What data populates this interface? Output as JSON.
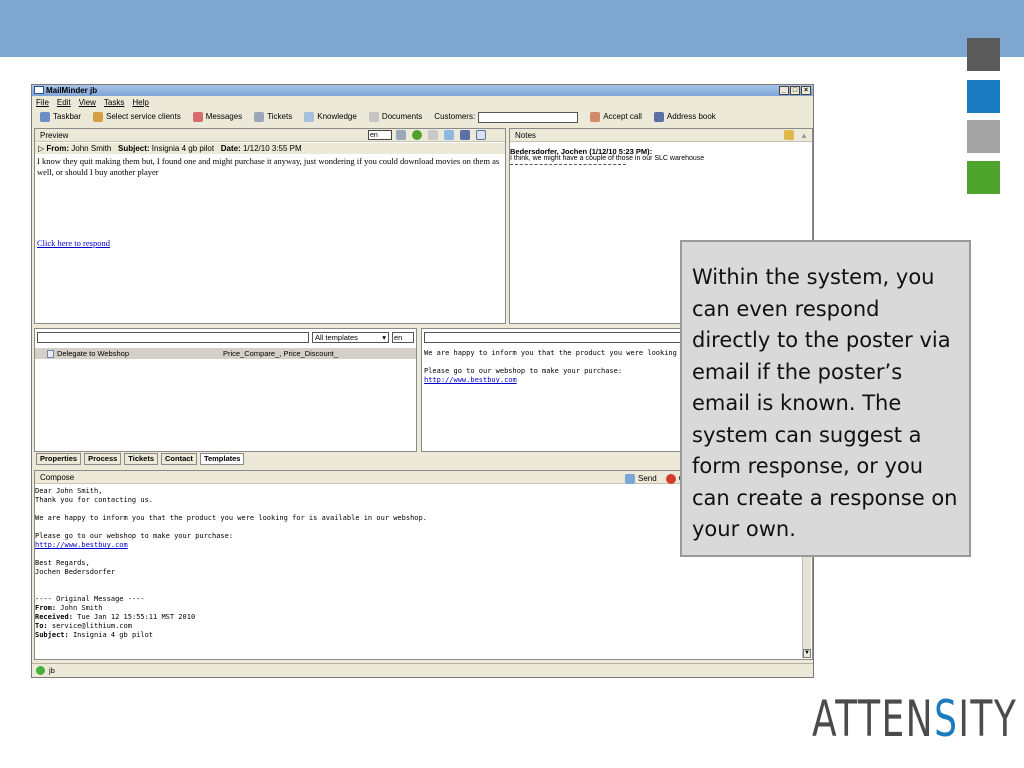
{
  "window": {
    "title": "MailMinder jb",
    "controls": [
      "_",
      "□",
      "×"
    ]
  },
  "menu": [
    "File",
    "Edit",
    "View",
    "Tasks",
    "Help"
  ],
  "toolbar": {
    "taskbar": "Taskbar",
    "select_clients": "Select service clients",
    "messages": "Messages",
    "tickets": "Tickets",
    "knowledge": "Knowledge",
    "documents": "Documents",
    "customers_label": "Customers:",
    "customers_value": "",
    "accept_call": "Accept call",
    "address_book": "Address book"
  },
  "preview": {
    "header": "Preview",
    "lang": "en",
    "from_label": "From:",
    "from_value": "John Smith",
    "subject_label": "Subject:",
    "subject_value": "Insignia 4 gb pilot",
    "date_label": "Date:",
    "date_value": "1/12/10 3:55 PM",
    "body": "I know they quit making them but, I found one and might purchase it anyway, just wondering if you could download movies on them as well, or should I buy another player",
    "respond_link": "Click here to respond"
  },
  "notes": {
    "header": "Notes",
    "author": "Bedersdorfer, Jochen (1/12/10 5:23 PM):",
    "text": "I think, we might have a couple of those in our SLC warehouse"
  },
  "templates": {
    "search_value": "",
    "filter": "All templates",
    "lang": "en",
    "rows": [
      {
        "name": "Delegate to Webshop",
        "tags": "Price_Compare_, Price_Discount_"
      }
    ],
    "preview_line1": "We are happy to inform you that the product you were looking for is",
    "preview_line2": "Please go to our webshop to make your purchase:",
    "preview_link": "http://www.bestbuy.com"
  },
  "tabs": [
    "Properties",
    "Process",
    "Tickets",
    "Contact",
    "Templates"
  ],
  "compose": {
    "header": "Compose",
    "send": "Send",
    "cancel": "C",
    "greeting": "Dear John Smith,",
    "thanks": "Thank you for contacting us.",
    "line1": "We are happy to inform you that the product you were looking for is available in our webshop.",
    "line2": "Please go to our webshop to make your purchase:",
    "link": "http://www.bestbuy.com",
    "regards": "Best Regards,",
    "signature": "Jochen Bedersdorfer",
    "orig_header": "---- Original Message ----",
    "orig_from_label": "From:",
    "orig_from": "John Smith",
    "orig_received_label": "Received:",
    "orig_received": "Tue Jan 12 15:55:11 MST 2010",
    "orig_to_label": "To:",
    "orig_to": "service@lithium.com",
    "orig_subject_label": "Subject:",
    "orig_subject": "Insignia 4 gb pilot"
  },
  "status": {
    "user": "jb"
  },
  "callout": {
    "text": "Within the system, you can even respond directly to the poster via email if the poster’s email is known. The system can suggest a form response, or you can create a response on your own."
  },
  "logo": {
    "part1": "ATTEN",
    "part2": "S",
    "part3": "ITY"
  },
  "colors": {
    "header_bar": "#7fa6cf",
    "square_dark": "#5a5a5a",
    "square_blue": "#1a7bc0",
    "square_gray": "#a3a3a3",
    "square_green": "#4da32c"
  }
}
